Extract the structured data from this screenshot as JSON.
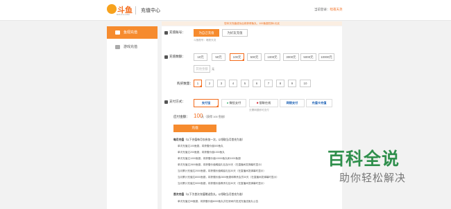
{
  "header": {
    "logo_text": "斗鱼",
    "logo_sub": "DOUYU.COM",
    "title": "充值中心",
    "user_label": "当前登录：",
    "user_name": "暗夜天尧"
  },
  "notice": "您本次充值成功后将获得鱼丸，100鱼翅兑换1元实",
  "sidebar": {
    "items": [
      {
        "label": "鱼翅充值",
        "active": true
      },
      {
        "label": "游戏充值",
        "active": false
      }
    ]
  },
  "account": {
    "label": "充值账号：",
    "self_btn": "为自己充值",
    "other_btn": "为好友充值",
    "helper": "斗鱼账号：暗夜天尧"
  },
  "amount": {
    "label": "充值数额：",
    "options": [
      "10元",
      "50元",
      "100元",
      "500元",
      "1000元",
      "3000元",
      "5000元",
      "10000元"
    ],
    "selected": "100元",
    "other_placeholder": "其他金额",
    "other_unit": "元"
  },
  "quantity": {
    "label": "购买数量：",
    "options": [
      "1",
      "2",
      "3",
      "4",
      "5",
      "6",
      "7",
      "8",
      "9",
      "10"
    ],
    "selected": "1"
  },
  "payment": {
    "label": "支付方式：",
    "options": [
      "支付宝",
      "微信支付",
      "银联在线",
      "网银支付",
      "充值卡充值"
    ],
    "selected": "支付宝",
    "helper": "无需网银即可支付"
  },
  "total": {
    "label": "应付金额：",
    "value": "100",
    "unit": "元（获得 100 鱼翅）"
  },
  "submit_label": "充值",
  "rules": {
    "monthly_title": "每月充值",
    "monthly_note": "（以下充值每月仅参加一次，以领取当月首充为准）",
    "lines": [
      "单次充值达100鱼翅，将获赠价值500鱼丸",
      "单次充值达200鱼翅，将获赠价值1000鱼丸",
      "单次充值达1000鱼翅，将获赠价值10000鱼丸和1000鱼翅",
      "单次充值达2800鱼翅，将获赠价值稀缺礼包及30天（在直播间发弹幕时显示）",
      "当月累计充值达2000鱼翅，将获赠价值稀缺礼包30天（在直播间发弹幕时显示）",
      "当月累计充值达8000鱼翅，将获赠价值2800鱼翅和尊贵会员30天（在直播间发弹幕时显示）",
      "当月累计充值达5000鱼翅，将获赠价值尊贵礼包30天（在直播间发弹幕时显示）"
    ],
    "first_title": "首次充值",
    "first_note": "（以下为首次充值赠送鱼丸，以领取当月首充为准）",
    "first_line": "单次充值达99鱼翅，将获赠价值6000鱼丸并在房间内发送充值送鱼丸公告"
  },
  "watermark": {
    "big": "百科全说",
    "small": "助你轻松解决"
  }
}
